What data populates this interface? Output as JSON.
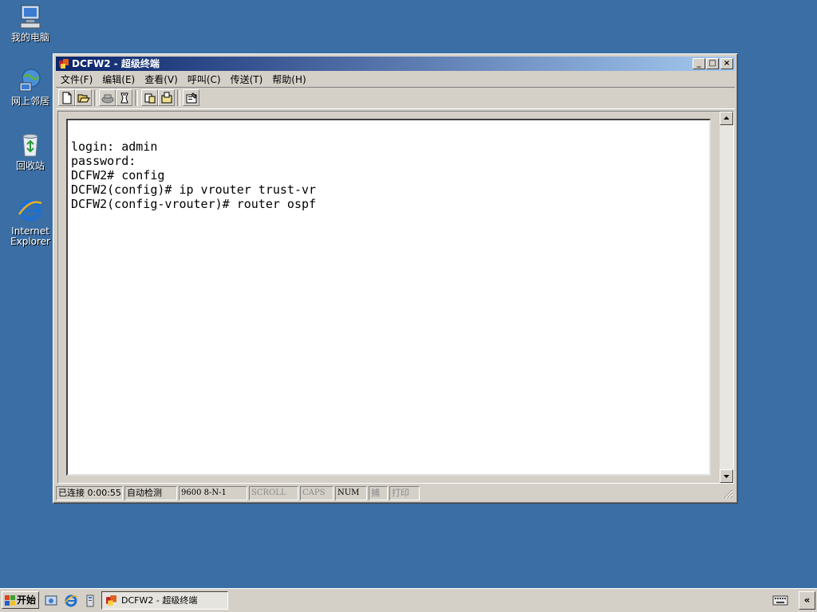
{
  "desktop": {
    "icons": [
      {
        "label": "我的电脑",
        "icon": "my-computer-icon"
      },
      {
        "label": "网上邻居",
        "icon": "network-places-icon"
      },
      {
        "label": "回收站",
        "icon": "recycle-bin-icon"
      },
      {
        "label_line1": "Internet",
        "label_line2": "Explorer",
        "icon": "internet-explorer-icon"
      }
    ]
  },
  "window": {
    "title": "DCFW2 - 超级终端",
    "controls": {
      "minimize": "_",
      "maximize": "□",
      "close": "×"
    },
    "menu": [
      "文件(F)",
      "编辑(E)",
      "查看(V)",
      "呼叫(C)",
      "传送(T)",
      "帮助(H)"
    ],
    "toolbar_icons": [
      "new-icon",
      "open-icon",
      "disconnect-icon",
      "connect-icon",
      "send-icon",
      "receive-icon",
      "properties-icon"
    ],
    "terminal": {
      "lines": [
        "login: admin",
        "password:",
        "DCFW2# config",
        "DCFW2(config)# ip vrouter trust-vr",
        "DCFW2(config-vrouter)# router ospf"
      ]
    },
    "status": {
      "connection": "已连接 0:00:55",
      "detect": "自动检测",
      "port_settings": "9600 8-N-1",
      "scroll": "SCROLL",
      "caps": "CAPS",
      "num": "NUM",
      "capture": "捕",
      "print": "打印"
    }
  },
  "taskbar": {
    "start_label": "开始",
    "quick_launch": [
      "show-desktop-icon",
      "internet-explorer-icon",
      "server-icon"
    ],
    "active_task": "DCFW2 - 超级终端",
    "tray": {
      "chevron": "«"
    }
  },
  "colors": {
    "desktop": "#3a6ea5",
    "title_active_start": "#0a246a",
    "title_active_end": "#a6caf0",
    "chrome": "#d4d0c8"
  }
}
